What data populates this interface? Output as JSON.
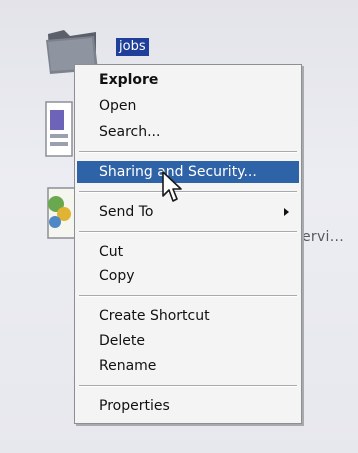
{
  "desktop": {
    "folder_label": "jobs",
    "peek_label": "ervi..."
  },
  "context_menu": {
    "items": [
      {
        "label": "Explore",
        "bold": true
      },
      {
        "label": "Open"
      },
      {
        "label": "Search..."
      },
      {
        "label": "Sharing and Security...",
        "highlighted": true
      },
      {
        "label": "Send To",
        "has_submenu": true
      },
      {
        "label": "Cut"
      },
      {
        "label": "Copy"
      },
      {
        "label": "Create Shortcut"
      },
      {
        "label": "Delete"
      },
      {
        "label": "Rename"
      },
      {
        "label": "Properties"
      }
    ]
  },
  "colors": {
    "selection": "#2f63a8",
    "folder_label_bg": "#1f3f9a",
    "menu_bg": "#f4f4f4"
  },
  "icons": [
    "folder-icon",
    "document-icon",
    "application-icon",
    "submenu-arrow-icon",
    "mouse-pointer-icon"
  ]
}
